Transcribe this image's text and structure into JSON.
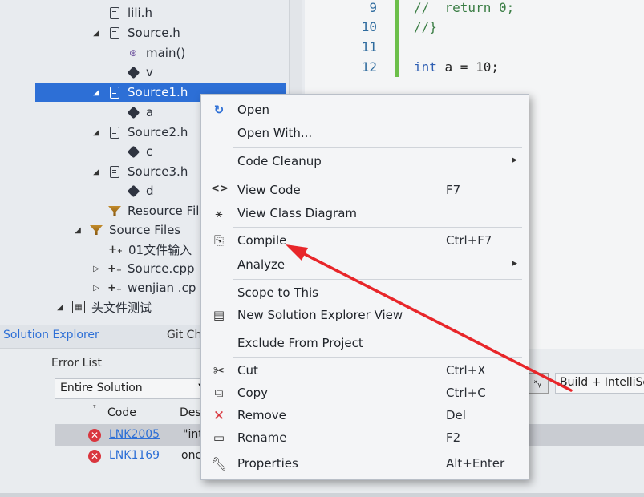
{
  "solution_explorer": {
    "items": [
      {
        "label": "lili.h",
        "icon": "file-icon",
        "expander": ""
      },
      {
        "label": "Source.h",
        "icon": "file-icon",
        "expander": "expanded"
      },
      {
        "label": "main()",
        "icon": "function-icon",
        "expander": ""
      },
      {
        "label": "v",
        "icon": "variable-icon",
        "expander": ""
      },
      {
        "label": "Source1.h",
        "icon": "file-icon",
        "expander": "expanded",
        "selected": true
      },
      {
        "label": "a",
        "icon": "variable-icon",
        "expander": ""
      },
      {
        "label": "Source2.h",
        "icon": "file-icon",
        "expander": "expanded"
      },
      {
        "label": "c",
        "icon": "variable-icon",
        "expander": ""
      },
      {
        "label": "Source3.h",
        "icon": "file-icon",
        "expander": "expanded"
      },
      {
        "label": "d",
        "icon": "variable-icon",
        "expander": ""
      },
      {
        "label": "Resource Files",
        "icon": "filter-icon",
        "expander": ""
      },
      {
        "label": "Source Files",
        "icon": "filter-icon",
        "expander": "expanded"
      },
      {
        "label": "01文件输入",
        "icon": "cpp-file-icon",
        "expander": ""
      },
      {
        "label": "Source.cpp",
        "icon": "cpp-file-icon",
        "expander": "collapsed"
      },
      {
        "label": "wenjian .cp",
        "icon": "cpp-file-icon",
        "expander": "collapsed"
      },
      {
        "label": "头文件测试",
        "icon": "project-icon",
        "expander": "expanded"
      }
    ],
    "tabs": [
      "Solution Explorer",
      "Git Ch"
    ]
  },
  "editor": {
    "lines": [
      {
        "num": "9",
        "code": "//  return 0;"
      },
      {
        "num": "10",
        "code": "//}"
      },
      {
        "num": "11",
        "code": ""
      },
      {
        "num": "12",
        "code": "int a = 10;"
      }
    ],
    "keyword": "int",
    "rest": " a = 10;"
  },
  "error_list": {
    "title": "Error List",
    "scope": "Entire Solution",
    "build_filter": "Build + IntelliSe",
    "columns": [
      "Code",
      "Desc"
    ],
    "rows": [
      {
        "code": "LNK2005",
        "desc": "\"int"
      },
      {
        "code": "LNK1169",
        "desc": "one"
      }
    ]
  },
  "context_menu": {
    "items": [
      {
        "label": "Open",
        "shortcut": "",
        "icon": "open-icon"
      },
      {
        "label": "Open With...",
        "shortcut": "",
        "icon": ""
      },
      {
        "label": "Code Cleanup",
        "shortcut": "",
        "icon": "",
        "submenu": true
      },
      {
        "label": "View Code",
        "shortcut": "F7",
        "icon": "code-icon"
      },
      {
        "label": "View Class Diagram",
        "shortcut": "",
        "icon": "class-diagram-icon"
      },
      {
        "label": "Compile",
        "shortcut": "Ctrl+F7",
        "icon": "compile-icon"
      },
      {
        "label": "Analyze",
        "shortcut": "",
        "icon": "",
        "submenu": true
      },
      {
        "label": "Scope to This",
        "shortcut": "",
        "icon": ""
      },
      {
        "label": "New Solution Explorer View",
        "shortcut": "",
        "icon": "new-view-icon"
      },
      {
        "label": "Exclude From Project",
        "shortcut": "",
        "icon": ""
      },
      {
        "label": "Cut",
        "shortcut": "Ctrl+X",
        "icon": "cut-icon"
      },
      {
        "label": "Copy",
        "shortcut": "Ctrl+C",
        "icon": "copy-icon"
      },
      {
        "label": "Remove",
        "shortcut": "Del",
        "icon": "remove-icon"
      },
      {
        "label": "Rename",
        "shortcut": "F2",
        "icon": "rename-icon"
      },
      {
        "label": "Properties",
        "shortcut": "Alt+Enter",
        "icon": "wrench-icon"
      }
    ]
  },
  "colors": {
    "selection": "#2d6fd6",
    "annotation_arrow": "#e8262a",
    "error_icon": "#d9363e",
    "link": "#2d6fd6"
  }
}
